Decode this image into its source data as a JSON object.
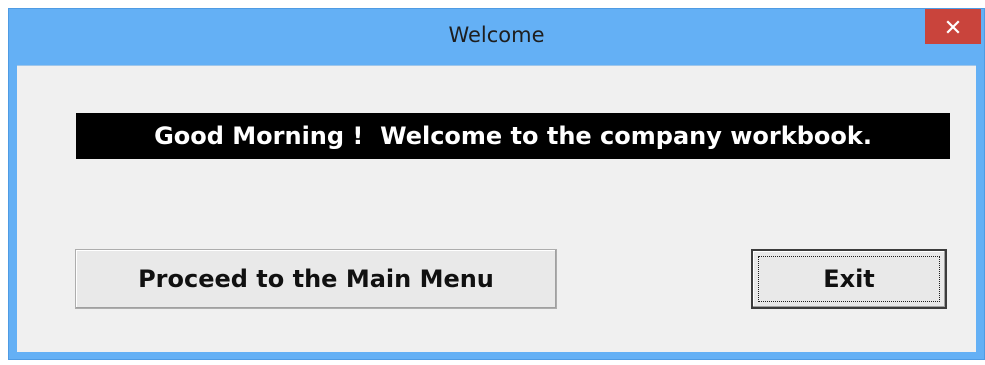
{
  "window": {
    "title": "Welcome",
    "close_icon": "close-icon"
  },
  "banner": {
    "text": "Good Morning !  Welcome to the company workbook."
  },
  "buttons": {
    "proceed_label": "Proceed to the Main Menu",
    "exit_label": "Exit"
  },
  "colors": {
    "titlebar": "#64b0f5",
    "close_button": "#c9443c",
    "banner_background": "#000000",
    "banner_text": "#ffffff",
    "client_background": "#f0f0f0"
  }
}
